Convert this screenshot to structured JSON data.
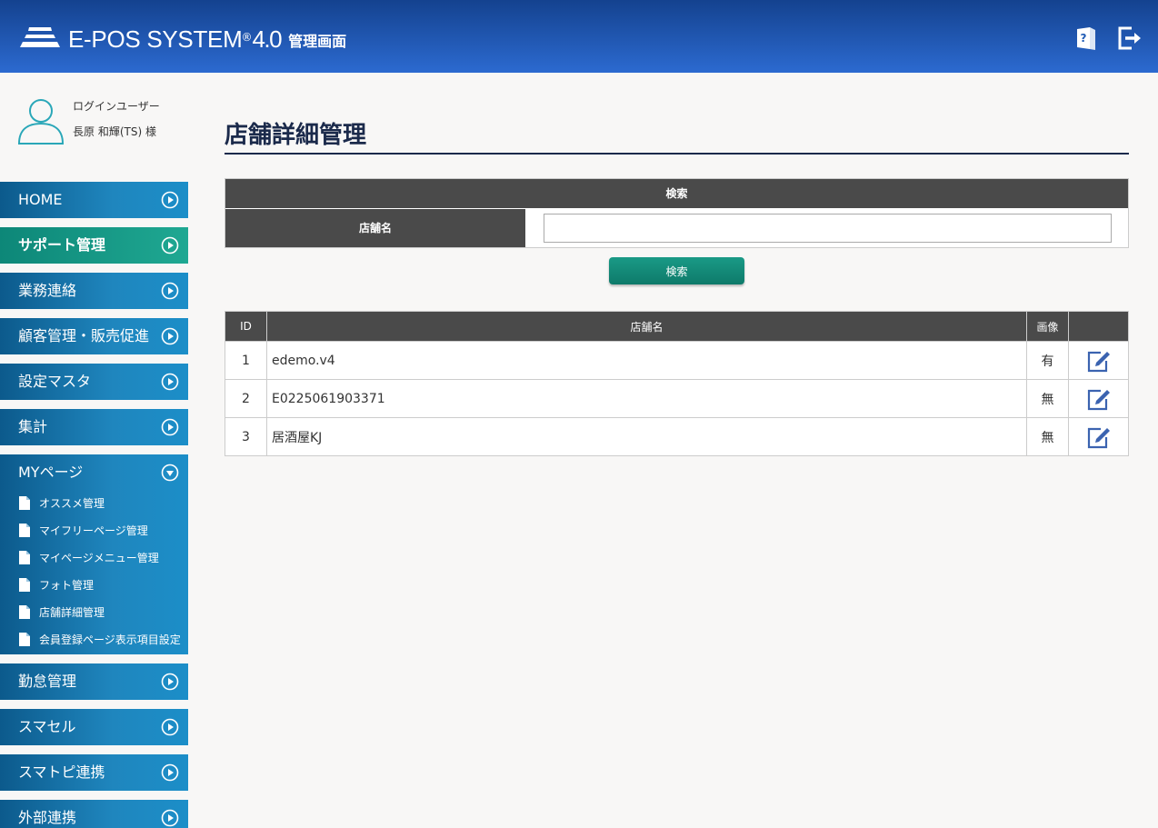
{
  "header": {
    "logo_text": "E-POS SYSTEM",
    "logo_reg": "®",
    "logo_version": "4.0",
    "logo_subtitle": "管理画面",
    "help_icon": "help-book-icon",
    "logout_icon": "logout-icon"
  },
  "user": {
    "label": "ログインユーザー",
    "name": "長原 和輝(TS) 様"
  },
  "sidebar": {
    "items": [
      {
        "label": "HOME"
      },
      {
        "label": "サポート管理",
        "active": true
      },
      {
        "label": "業務連絡"
      },
      {
        "label": "顧客管理・販売促進"
      },
      {
        "label": "設定マスタ"
      },
      {
        "label": "集計"
      },
      {
        "label": "MYページ",
        "expanded": true
      },
      {
        "label": "勤怠管理"
      },
      {
        "label": "スマセル"
      },
      {
        "label": "スマトピ連携"
      },
      {
        "label": "外部連携"
      }
    ],
    "submenu": [
      {
        "label": "オススメ管理"
      },
      {
        "label": "マイフリーページ管理"
      },
      {
        "label": "マイページメニュー管理"
      },
      {
        "label": "フォト管理"
      },
      {
        "label": "店舗詳細管理"
      },
      {
        "label": "会員登録ページ表示項目設定"
      }
    ]
  },
  "main": {
    "title": "店舗詳細管理",
    "search": {
      "header": "検索",
      "field_label": "店舗名",
      "field_value": "",
      "button_label": "検索"
    },
    "table": {
      "columns": [
        "ID",
        "店舗名",
        "画像",
        ""
      ],
      "rows": [
        {
          "id": "1",
          "name": "edemo.v4",
          "image": "有"
        },
        {
          "id": "2",
          "name": "E0225061903371",
          "image": "無"
        },
        {
          "id": "3",
          "name": "居酒屋KJ",
          "image": "無"
        }
      ]
    }
  },
  "colors": {
    "header_top": "#14428f",
    "header_bottom": "#2c6ad0",
    "nav_blue": "#1f86be",
    "nav_active": "#1fa892",
    "title_navy": "#1b2a4b",
    "table_head": "#4a4a4a"
  }
}
